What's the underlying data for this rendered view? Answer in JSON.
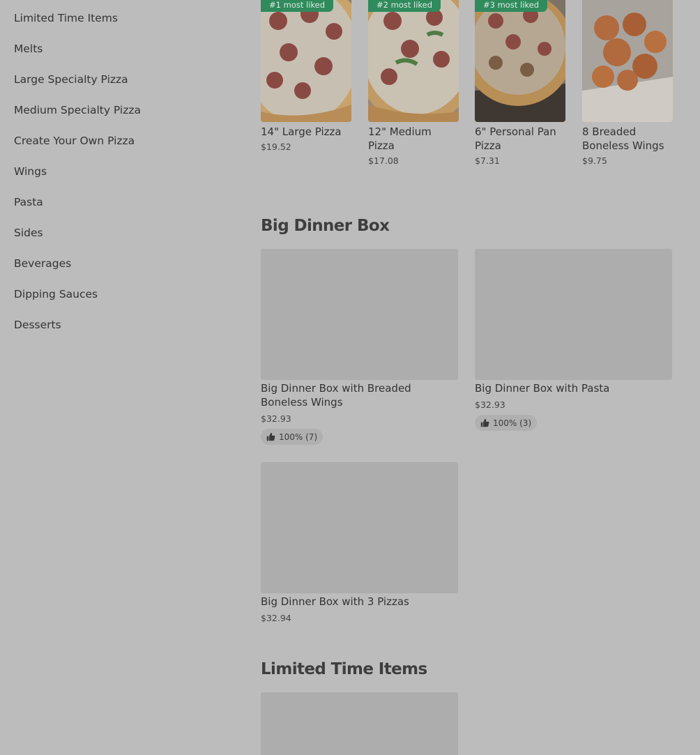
{
  "sidebar": {
    "items": [
      {
        "label": "Limited Time Items"
      },
      {
        "label": "Melts"
      },
      {
        "label": "Large Specialty Pizza"
      },
      {
        "label": "Medium Specialty Pizza"
      },
      {
        "label": "Create Your Own Pizza"
      },
      {
        "label": "Wings"
      },
      {
        "label": "Pasta"
      },
      {
        "label": "Sides"
      },
      {
        "label": "Beverages"
      },
      {
        "label": "Dipping Sauces"
      },
      {
        "label": "Desserts"
      }
    ]
  },
  "popular": {
    "items": [
      {
        "badge": "#1 most liked",
        "name": "14\" Large Pizza",
        "price": "$19.52"
      },
      {
        "badge": "#2 most liked",
        "name": "12\" Medium Pizza",
        "price": "$17.08"
      },
      {
        "badge": "#3 most liked",
        "name": "6\" Personal Pan Pizza",
        "price": "$7.31"
      },
      {
        "badge": "",
        "name": "8 Breaded Boneless Wings",
        "price": "$9.75"
      }
    ]
  },
  "big_dinner_box": {
    "title": "Big Dinner Box",
    "items": [
      {
        "name": "Big Dinner Box with Breaded Boneless Wings",
        "price": "$32.93",
        "rating": "100% (7)"
      },
      {
        "name": "Big Dinner Box with Pasta",
        "price": "$32.93",
        "rating": "100% (3)"
      },
      {
        "name": "Big Dinner Box with 3 Pizzas",
        "price": "$32.94",
        "rating": ""
      }
    ]
  },
  "limited_time": {
    "title": "Limited Time Items"
  },
  "colors": {
    "overlay_background": "#bcbcbc",
    "badge_green": "#2f8a5c",
    "placeholder_gray": "#adadad"
  }
}
